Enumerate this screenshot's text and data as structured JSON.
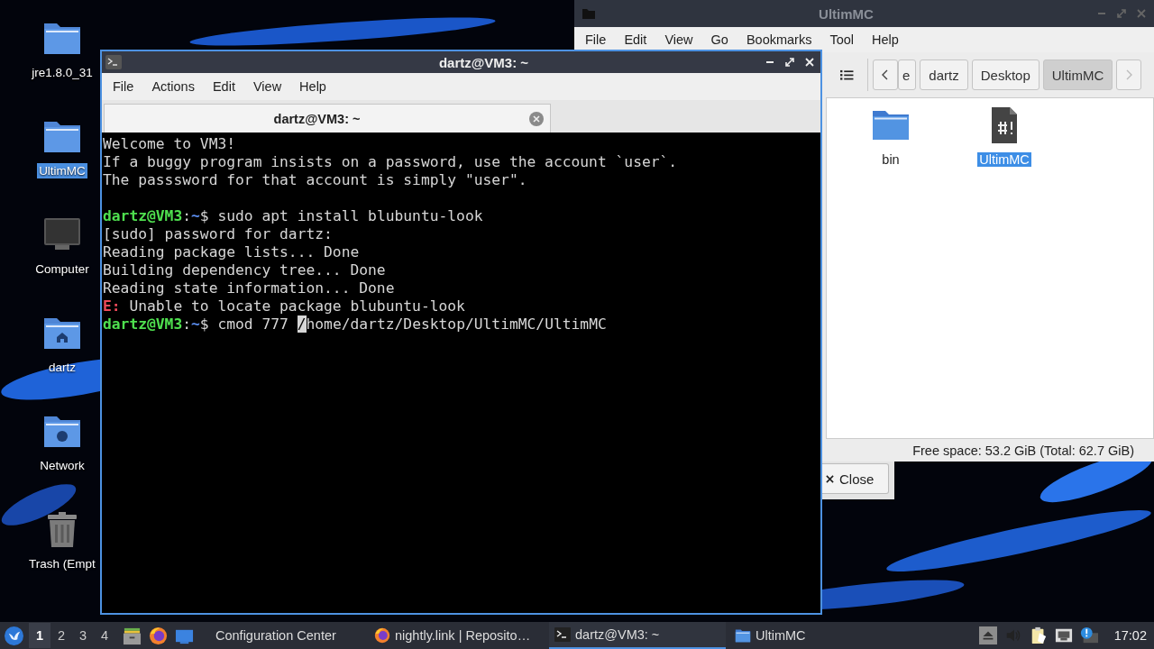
{
  "desktop_icons": [
    {
      "label": "jre1.8.0_31",
      "kind": "folder",
      "selected": false
    },
    {
      "label": "UltimMC",
      "kind": "folder",
      "selected": true
    },
    {
      "label": "Computer",
      "kind": "computer",
      "selected": false
    },
    {
      "label": "dartz",
      "kind": "home",
      "selected": false
    },
    {
      "label": "Network",
      "kind": "network",
      "selected": false
    },
    {
      "label": "Trash (Empt",
      "kind": "trash",
      "selected": false
    }
  ],
  "dialog": {
    "close_button": "Close"
  },
  "file_manager": {
    "title": "UltimMC",
    "menu": [
      "File",
      "Edit",
      "View",
      "Go",
      "Bookmarks",
      "Tool",
      "Help"
    ],
    "back_disabled": false,
    "forward_disabled": true,
    "path": [
      {
        "label": "e",
        "selected": false
      },
      {
        "label": "dartz",
        "selected": false
      },
      {
        "label": "Desktop",
        "selected": false
      },
      {
        "label": "UltimMC",
        "selected": true
      }
    ],
    "items": [
      {
        "label": "bin",
        "kind": "folder",
        "selected": false
      },
      {
        "label": "UltimMC",
        "kind": "script",
        "selected": true
      }
    ],
    "status": "Free space: 53.2 GiB (Total: 62.7 GiB)"
  },
  "terminal": {
    "title": "dartz@VM3: ~",
    "menu": [
      "File",
      "Actions",
      "Edit",
      "View",
      "Help"
    ],
    "tabs": [
      {
        "label": "dartz@VM3: ~",
        "selected": true
      }
    ],
    "lines": [
      {
        "kind": "output",
        "parts": [
          {
            "kind": "plain",
            "text": "Welcome to VM3!"
          }
        ]
      },
      {
        "kind": "output",
        "parts": [
          {
            "kind": "plain",
            "text": "If a buggy program insists on a password, use the account `user`."
          }
        ]
      },
      {
        "kind": "output",
        "parts": [
          {
            "kind": "plain",
            "text": "The passsword for that account is simply \"user\"."
          }
        ]
      },
      {
        "kind": "blank"
      },
      {
        "kind": "output",
        "parts": [
          {
            "kind": "user",
            "text": "dartz@VM3"
          },
          {
            "kind": "plain",
            "text": ":"
          },
          {
            "kind": "path",
            "text": "~"
          },
          {
            "kind": "plain",
            "text": "$ sudo apt install blubuntu-look"
          }
        ]
      },
      {
        "kind": "output",
        "parts": [
          {
            "kind": "plain",
            "text": "[sudo] password for dartz:"
          }
        ]
      },
      {
        "kind": "output",
        "parts": [
          {
            "kind": "plain",
            "text": "Reading package lists... Done"
          }
        ]
      },
      {
        "kind": "output",
        "parts": [
          {
            "kind": "plain",
            "text": "Building dependency tree... Done"
          }
        ]
      },
      {
        "kind": "output",
        "parts": [
          {
            "kind": "plain",
            "text": "Reading state information... Done"
          }
        ]
      },
      {
        "kind": "output",
        "parts": [
          {
            "kind": "error",
            "text": "E:"
          },
          {
            "kind": "plain",
            "text": " Unable to locate package blubuntu-look"
          }
        ]
      },
      {
        "kind": "output",
        "parts": [
          {
            "kind": "user",
            "text": "dartz@VM3"
          },
          {
            "kind": "plain",
            "text": ":"
          },
          {
            "kind": "path",
            "text": "~"
          },
          {
            "kind": "plain",
            "text": "$ cmod 777 "
          },
          {
            "kind": "cursor",
            "text": "/"
          },
          {
            "kind": "plain",
            "text": "home/dartz/Desktop/UltimMC/UltimMC"
          }
        ]
      }
    ]
  },
  "taskbar": {
    "workspaces": [
      {
        "label": "1",
        "selected": true
      },
      {
        "label": "2",
        "selected": false
      },
      {
        "label": "3",
        "selected": false
      },
      {
        "label": "4",
        "selected": false
      }
    ],
    "launchers": [
      {
        "kind": "files"
      },
      {
        "kind": "firefox"
      },
      {
        "kind": "desktop"
      }
    ],
    "tasks": [
      {
        "label": "Configuration Center",
        "kind": "plain",
        "selected": false
      },
      {
        "label": "nightly.link | Reposito…",
        "kind": "browser",
        "selected": false
      },
      {
        "label": "dartz@VM3: ~",
        "kind": "terminal",
        "selected": true
      },
      {
        "label": "UltimMC",
        "kind": "folder",
        "selected": false
      }
    ],
    "clock": "17:02"
  }
}
